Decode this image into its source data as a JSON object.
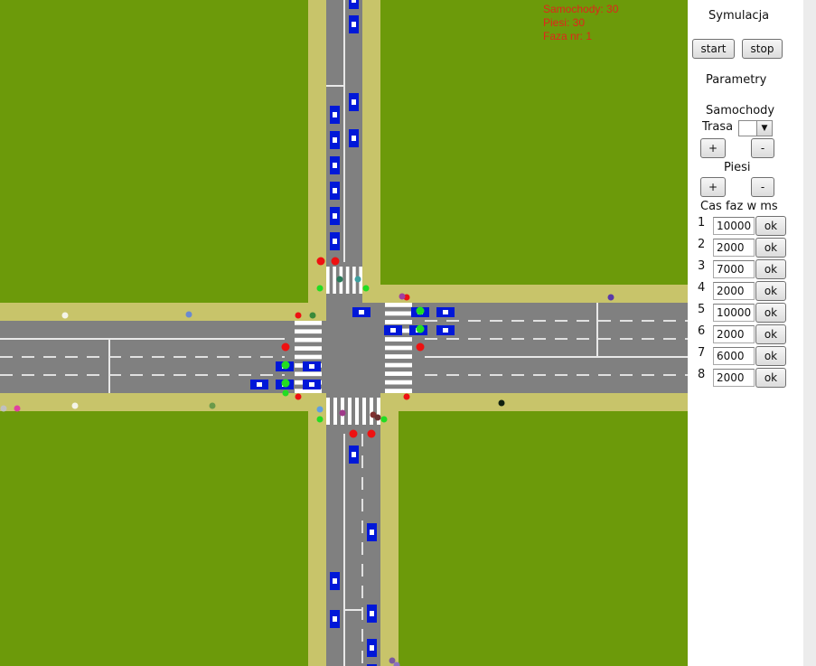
{
  "stats": {
    "cars_line": "Samochody: 30",
    "pedestrians_line": "Piesi: 30",
    "phase_line": "Faza nr: 1"
  },
  "panel": {
    "simulation_title": "Symulacja",
    "start_label": "start",
    "stop_label": "stop",
    "parameters_title": "Parametry",
    "cars_title": "Samochody",
    "route_label": "Trasa",
    "route_value": "",
    "route_arrow_icon": "triangle-down-icon",
    "cars_plus": "+",
    "cars_minus": "-",
    "pedestrians_title": "Piesi",
    "ped_plus": "+",
    "ped_minus": "-",
    "phase_time_title": "Cas faz w ms",
    "ok_label": "ok",
    "phases": [
      {
        "num": "1",
        "value": "10000"
      },
      {
        "num": "2",
        "value": "2000"
      },
      {
        "num": "3",
        "value": "7000"
      },
      {
        "num": "4",
        "value": "2000"
      },
      {
        "num": "5",
        "value": "10000"
      },
      {
        "num": "6",
        "value": "2000"
      },
      {
        "num": "7",
        "value": "6000"
      },
      {
        "num": "8",
        "value": "2000"
      }
    ]
  },
  "colors": {
    "grass": "#6c9a0a",
    "sidewalk": "#c8c46a",
    "road": "#808080",
    "car_body": "#0018d8",
    "light_red": "#ee1111",
    "light_green": "#22dd22",
    "stats_text": "#e0251b"
  },
  "traffic_lights": {
    "north": {
      "west_pole": "red",
      "east_pole": "red",
      "walk_west": "green",
      "walk_east": "green"
    },
    "west": {
      "upper": "red",
      "mid": "green",
      "lower": "green",
      "walk": "red"
    },
    "east": {
      "upper": "red",
      "mid": "green",
      "lower": "red"
    },
    "south": {
      "west_pole": "red",
      "east_pole": "red",
      "walk_west": "green",
      "walk_east": "green"
    }
  }
}
